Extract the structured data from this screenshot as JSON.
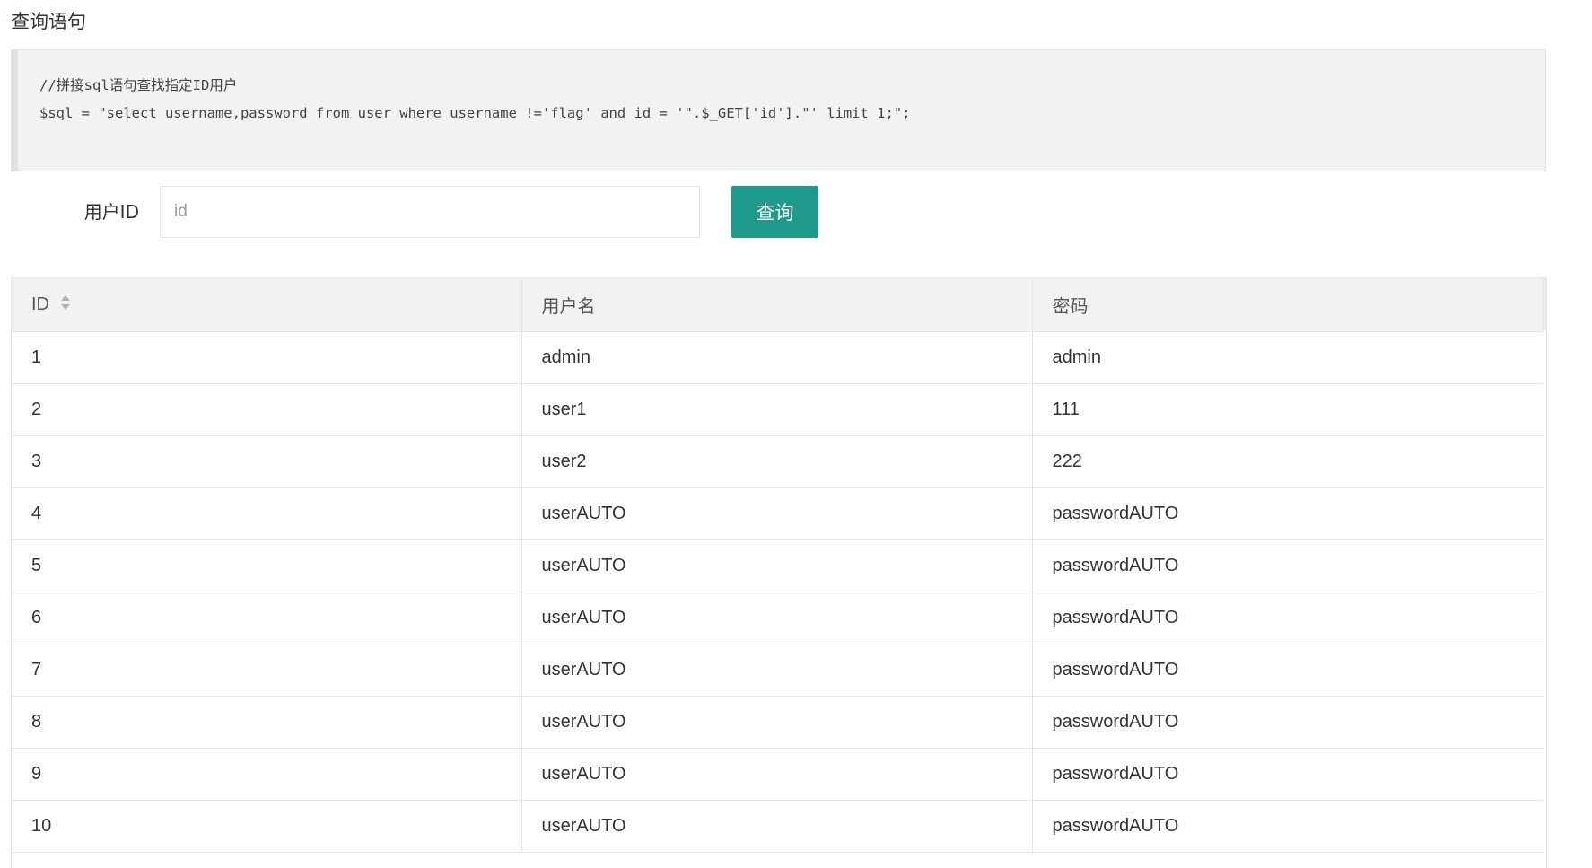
{
  "section": {
    "title": "查询语句"
  },
  "code": {
    "comment": "//拼接sql语句查找指定ID用户",
    "statement": "$sql = \"select username,password from user where username !='flag' and id = '\".$_GET['id'].\"' limit 1;\";"
  },
  "form": {
    "label": "用户ID",
    "input_value": "",
    "input_placeholder": "id",
    "button_label": "查询"
  },
  "table": {
    "columns": [
      "ID",
      "用户名",
      "密码"
    ],
    "sort_icon": "sort-icon",
    "rows": [
      [
        "1",
        "admin",
        "admin"
      ],
      [
        "2",
        "user1",
        "111"
      ],
      [
        "3",
        "user2",
        "222"
      ],
      [
        "4",
        "userAUTO",
        "passwordAUTO"
      ],
      [
        "5",
        "userAUTO",
        "passwordAUTO"
      ],
      [
        "6",
        "userAUTO",
        "passwordAUTO"
      ],
      [
        "7",
        "userAUTO",
        "passwordAUTO"
      ],
      [
        "8",
        "userAUTO",
        "passwordAUTO"
      ],
      [
        "9",
        "userAUTO",
        "passwordAUTO"
      ],
      [
        "10",
        "userAUTO",
        "passwordAUTO"
      ]
    ]
  },
  "colors": {
    "accent": "#1e9a8c",
    "code_background": "#f2f2f2",
    "header_background": "#f2f2f2"
  }
}
